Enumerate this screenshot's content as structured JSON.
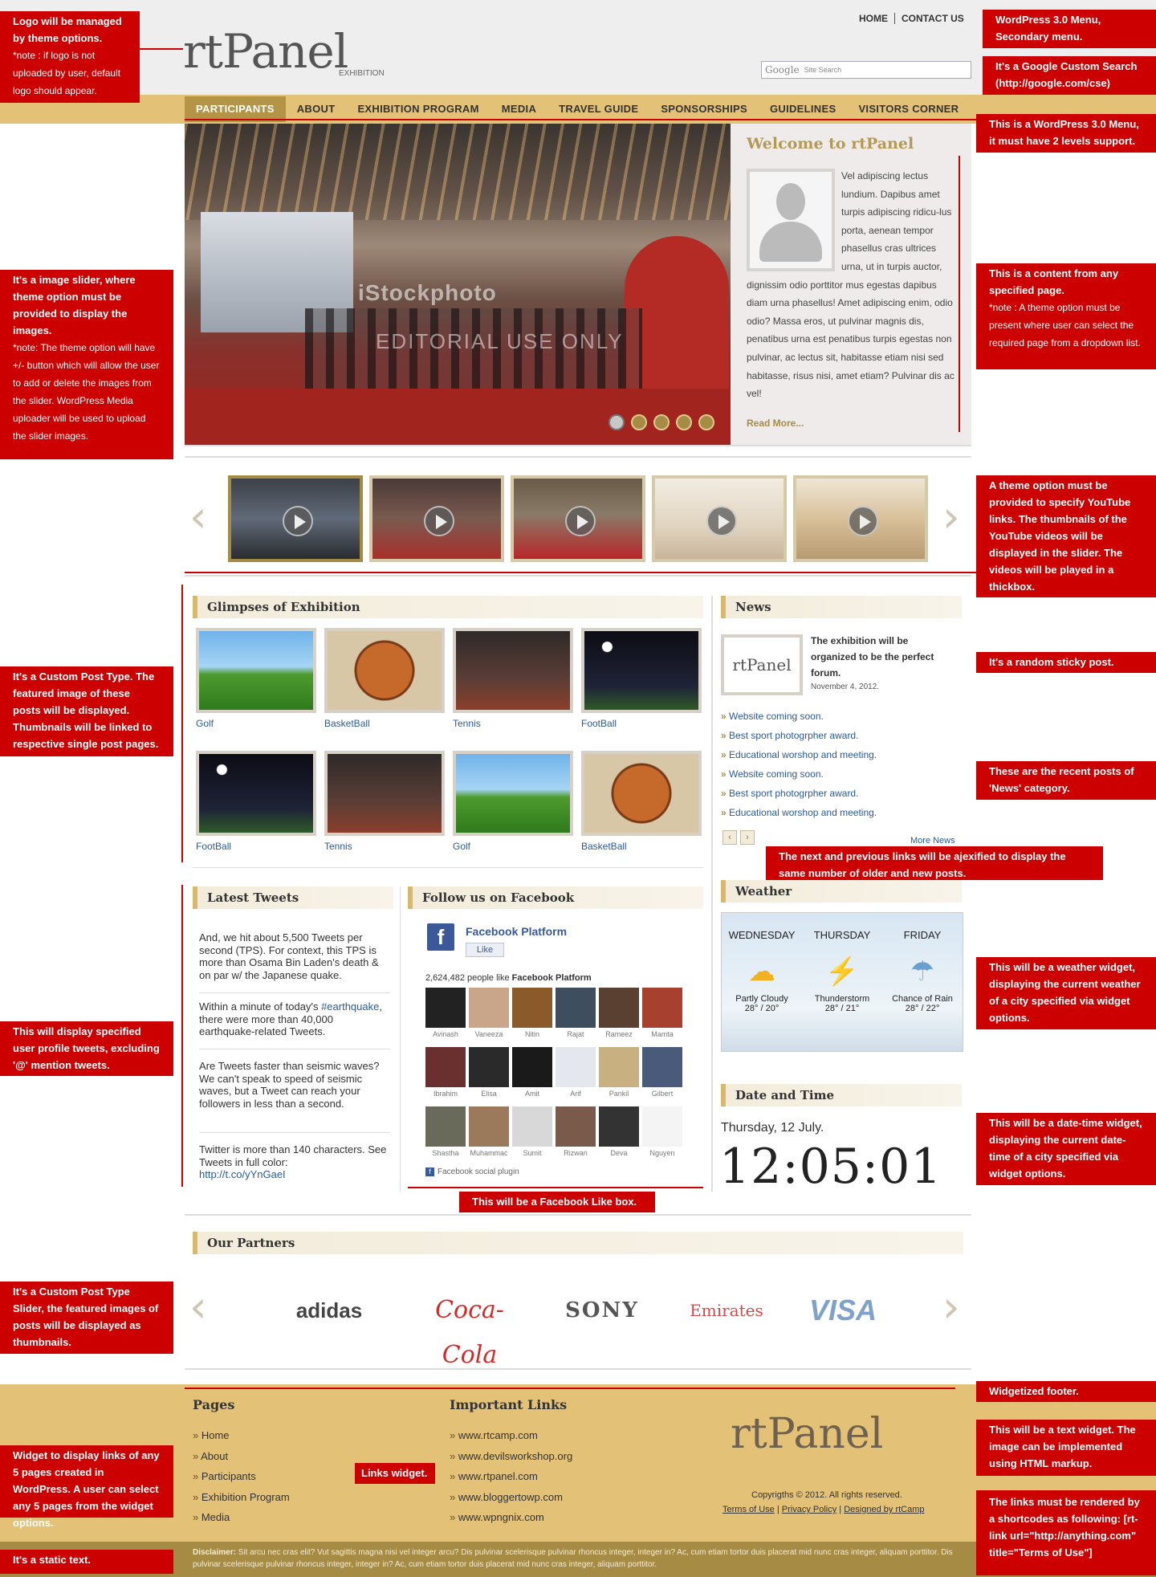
{
  "header": {
    "logo": "rtPanel",
    "logo_sub": "EXHIBITION",
    "secondary_menu": [
      "HOME",
      "CONTACT US"
    ],
    "search_google": "Google",
    "search_placeholder": "Site Search"
  },
  "main_menu": [
    "PARTICIPANTS",
    "ABOUT",
    "EXHIBITION PROGRAM",
    "MEDIA",
    "TRAVEL GUIDE",
    "SPONSORSHIPS",
    "GUIDELINES",
    "VISITORS CORNER"
  ],
  "slider": {
    "watermark": "iStockphoto",
    "watermark2": "EDITORIAL USE ONLY",
    "active_dot": 1,
    "dot_count": 5
  },
  "welcome": {
    "title": "Welcome to rtPanel",
    "text": "Vel adipiscing lectus lundium. Dapibus amet turpis adipiscing ridicu-lus porta, aenean tempor phasellus cras ultrices urna, ut in turpis auctor, dignissim odio porttitor mus egestas dapibus diam urna phasellus! Amet adipiscing enim, odio odio? Massa eros, ut pulvinar magnis dis, penatibus urna est penatibus turpis egestas non pulvinar, ac lectus sit, habitasse etiam nisi sed habitasse, risus nisi, amet etiam? Pulvinar dis ac vel!",
    "read_more": "Read More..."
  },
  "glimpses": {
    "title": "Glimpses of Exhibition",
    "items": [
      "Golf",
      "BasketBall",
      "Tennis",
      "FootBall",
      "FootBall",
      "Tennis",
      "Golf",
      "BasketBall"
    ]
  },
  "news": {
    "title": "News",
    "sticky_logo": "rtPanel",
    "sticky_text": "The exhibition will be organized to be the perfect forum.",
    "sticky_date": "November 4, 2012.",
    "items": [
      "Website coming soon.",
      "Best sport photogrpher award.",
      "Educational worshop and meeting.",
      "Website coming soon.",
      "Best sport photogrpher award.",
      "Educational worshop and meeting."
    ],
    "prev": "‹",
    "next": "›",
    "more": "More News"
  },
  "tweets": {
    "title": "Latest Tweets",
    "t1": "And, we hit about 5,500 Tweets per second (TPS). For context, this TPS is more than Osama Bin Laden's death & on par w/ the Japanese quake.",
    "t2a": "Within a minute of today's ",
    "t2tag": "#earthquake",
    "t2b": ", there were more than 40,000 earthquake-related Tweets.",
    "t3": "Are Tweets faster than seismic waves? We can't speak to speed of seismic waves, but a Tweet can reach your followers in less than a second.",
    "t4": "Twitter is more than 140 characters. See Tweets in full color:",
    "t4link": "http://t.co/yYnGaeI"
  },
  "facebook": {
    "title": "Follow us on Facebook",
    "page": "Facebook Platform",
    "like": "Like",
    "count_pre": "2,624,482 people like ",
    "count_page": "Facebook Platform",
    "fans": [
      "Avinash",
      "Vaneeza",
      "Nitin",
      "Rajat",
      "Rameez",
      "Mamta",
      "Ibrahim",
      "Elisa",
      "Amit",
      "Arif",
      "Pankil",
      "Gilbert",
      "Shastha",
      "Muhammac",
      "Sumit",
      "Rizwan",
      "Deva",
      "Nguyen"
    ],
    "fan_colors": [
      "#222",
      "#c9a58a",
      "#8a5a2a",
      "#3e4e5e",
      "#5a4030",
      "#a84030",
      "#6a3030",
      "#2a2a2a",
      "#1a1a1a",
      "#e4e8ee",
      "#c8b080",
      "#4a5a7a",
      "#6a6a5a",
      "#9a7a5a",
      "#d8d8d8",
      "#7a5a4a",
      "#333",
      "#f4f4f4"
    ],
    "footer": "Facebook social plugin"
  },
  "weather": {
    "title": "Weather",
    "days": [
      {
        "day": "WEDNESDAY",
        "cond": "Partly Cloudy",
        "temp": "28° / 20°",
        "icon": "partly-cloudy-icon"
      },
      {
        "day": "THURSDAY",
        "cond": "Thunderstorm",
        "temp": "28° / 21°",
        "icon": "thunderstorm-icon"
      },
      {
        "day": "FRIDAY",
        "cond": "Chance of Rain",
        "temp": "28° / 22°",
        "icon": "rain-icon"
      }
    ]
  },
  "datetime": {
    "title": "Date and Time",
    "date": "Thursday, 12 July.",
    "time": "12:05:01"
  },
  "partners": {
    "title": "Our Partners",
    "logos": [
      "adidas",
      "Coca-Cola",
      "SONY",
      "Emirates",
      "VISA"
    ]
  },
  "footer": {
    "pages_title": "Pages",
    "pages": [
      "Home",
      "About",
      "Participants",
      "Exhibition Program",
      "Media"
    ],
    "links_title": "Important Links",
    "links": [
      "www.rtcamp.com",
      "www.devilsworkshop.org",
      "www.rtpanel.com",
      "www.bloggertowp.com",
      "www.wpngnix.com"
    ],
    "logo": "rtPanel",
    "copyright": "Copyrigths © 2012. All rights reserved.",
    "terms": "Terms of Use",
    "privacy": "Privacy Policy",
    "designed": "Designed by rtCamp",
    "disclaimer_label": "Disclaimer:",
    "disclaimer": " Sit arcu nec cras elit? Vut sagittis magna nisi vel integer arcu? Dis pulvinar scelerisque pulvinar rhoncus integer, integer in? Ac, cum etiam tortor duis placerat mid nunc cras integer, aliquam porttitor. Dis pulvinar scelerisque pulvinar rhoncus integer, integer in? Ac, cum etiam tortor duis placerat mid nunc cras integer, aliquam porttitor."
  },
  "annotations": {
    "a_logo": "Logo will be managed by theme options.",
    "a_logo_note": "*note : if logo is not uploaded by user, default logo should appear.",
    "a_secmenu": "WordPress 3.0 Menu, Secondary menu.",
    "a_search": "It's a Google Custom Search (http://google.com/cse)",
    "a_menu": "This is a WordPress 3.0 Menu, it must have 2 levels support.",
    "a_slider": "It's a image slider, where theme option must be provided to display the images.",
    "a_slider_note": "*note: The theme option will have +/- button which will allow the user to add or delete the images from the slider. WordPress Media uploader will be used to upload the slider images.",
    "a_content": "This is a content from any specified page.",
    "a_content_note": "*note : A theme option must be present where user can select the required page from a dropdown list.",
    "a_youtube": "A theme option must be provided to specify YouTube links. The thumbnails of the YouTube videos will be displayed in the slider. The videos will be played in a thickbox.",
    "a_cpt": "It's a Custom Post Type. The featured image of these posts will be displayed. Thumbnails will be linked to respective single post pages.",
    "a_sticky": "It's a random sticky post.",
    "a_recent": "These are the recent posts of 'News' category.",
    "a_next": "The next and previous links will be ajexified to display the same number of older and new posts.",
    "a_tweets": "This will display specified user profile tweets, excluding '@' mention tweets.",
    "a_weather": "This will be a weather widget, displaying the current weather of a city specified via widget options.",
    "a_datetime": "This will be a date-time widget, displaying the current date-time of a city specified via widget options.",
    "a_fb": "This will be a Facebook Like box.",
    "a_partners": "It's a Custom Post Type Slider, the featured images of posts will be displayed as thumbnails.",
    "a_footer": "Widgetized footer.",
    "a_text": "This will be a text widget. The image can be implemented using HTML markup.",
    "a_pages": "Widget to display links of any 5 pages created in WordPress. A user can select any 5 pages from the widget options.",
    "a_links": "Links widget.",
    "a_shortcode": "The links must be rendered by a shortcodes as following: [rt-link url=\"http://anything.com\" title=\"Terms of Use\"]",
    "a_static": "It's a static text."
  },
  "colors": {
    "gold": "#e3c177",
    "gold_dark": "#a68b45",
    "annotation_red": "#cc0000",
    "link_blue": "#2a5b9a"
  }
}
